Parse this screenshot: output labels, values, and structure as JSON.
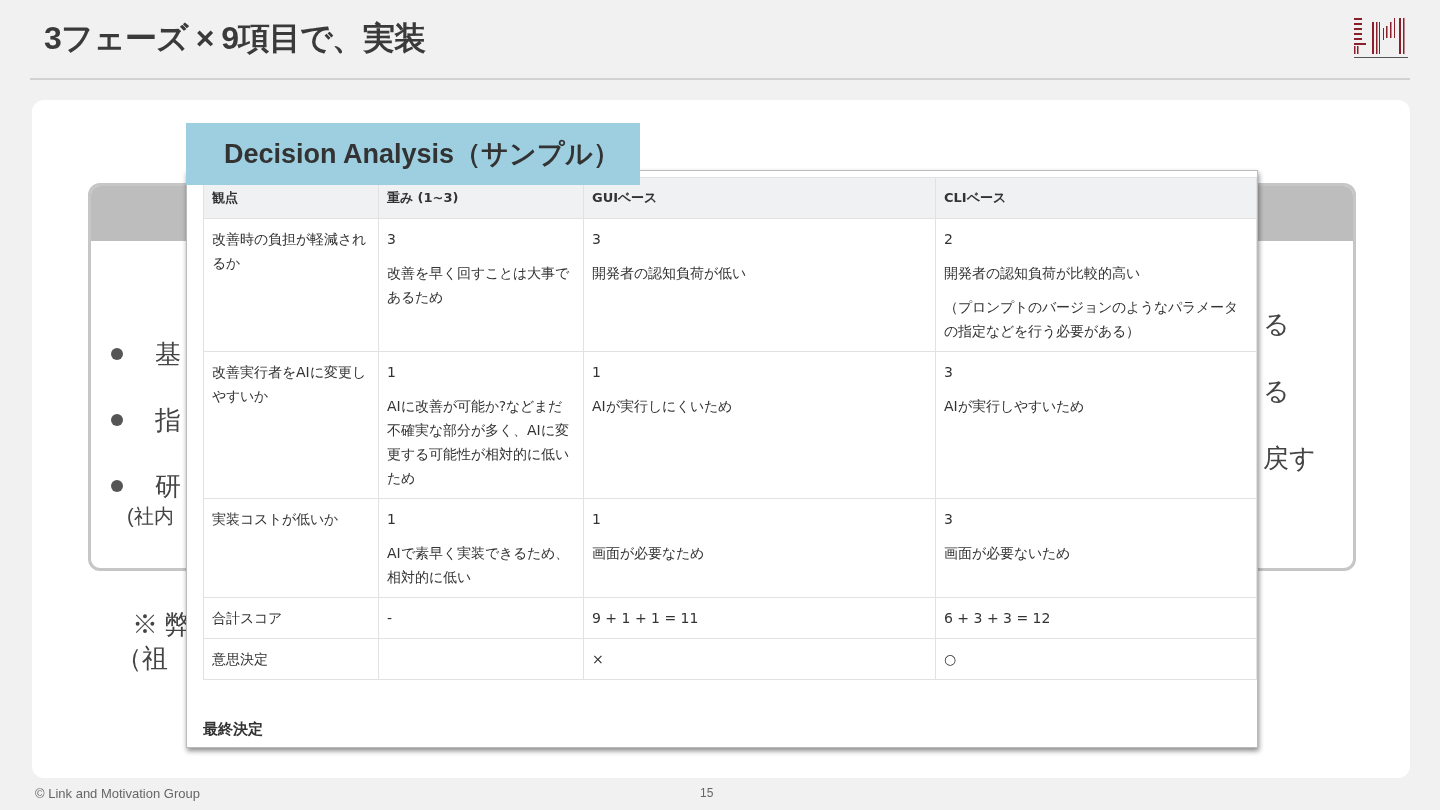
{
  "slide": {
    "title": "3フェーズ × 9項目で、実装"
  },
  "background_box": {
    "left_items": [
      {
        "text": "基"
      },
      {
        "text": "指"
      },
      {
        "text": "研",
        "note": "(社内"
      }
    ],
    "right_fragments": [
      "る",
      "る",
      "戻す"
    ]
  },
  "note": {
    "lines": [
      "※ 弊",
      "（祖"
    ]
  },
  "screenshot": {
    "label": "Decision Analysis（サンプル）",
    "columns": [
      "観点",
      "重み (1~3)",
      "GUIベース",
      "CLIベース"
    ],
    "rows": [
      {
        "cells": [
          [
            "改善時の負担が軽減されるか"
          ],
          [
            "3",
            "改善を早く回すことは大事であるため"
          ],
          [
            "3",
            "開発者の認知負荷が低い"
          ],
          [
            "2",
            "開発者の認知負荷が比較的高い",
            "（プロンプトのバージョンのようなパラメータの指定などを行う必要がある）"
          ]
        ]
      },
      {
        "cells": [
          [
            "改善実行者をAIに変更しやすいか"
          ],
          [
            "1",
            "AIに改善が可能か?などまだ不確実な部分が多く、AIに変更する可能性が相対的に低いため"
          ],
          [
            "1",
            "AIが実行しにくいため"
          ],
          [
            "3",
            "AIが実行しやすいため"
          ]
        ]
      },
      {
        "cells": [
          [
            "実装コストが低いか"
          ],
          [
            "1",
            "AIで素早く実装できるため、相対的に低い"
          ],
          [
            "1",
            "画面が必要なため"
          ],
          [
            "3",
            "画面が必要ないため"
          ]
        ]
      },
      {
        "cells": [
          [
            "合計スコア"
          ],
          [
            "-"
          ],
          [
            "9 + 1 + 1 = 11"
          ],
          [
            "6 + 3 + 3 = 12"
          ]
        ]
      },
      {
        "cells": [
          [
            "意思決定"
          ],
          [],
          [
            "×"
          ],
          [
            "○"
          ]
        ]
      }
    ],
    "section_heading": "最終決定"
  },
  "footer": {
    "copyright": "© Link and Motivation Group",
    "page": "15"
  }
}
